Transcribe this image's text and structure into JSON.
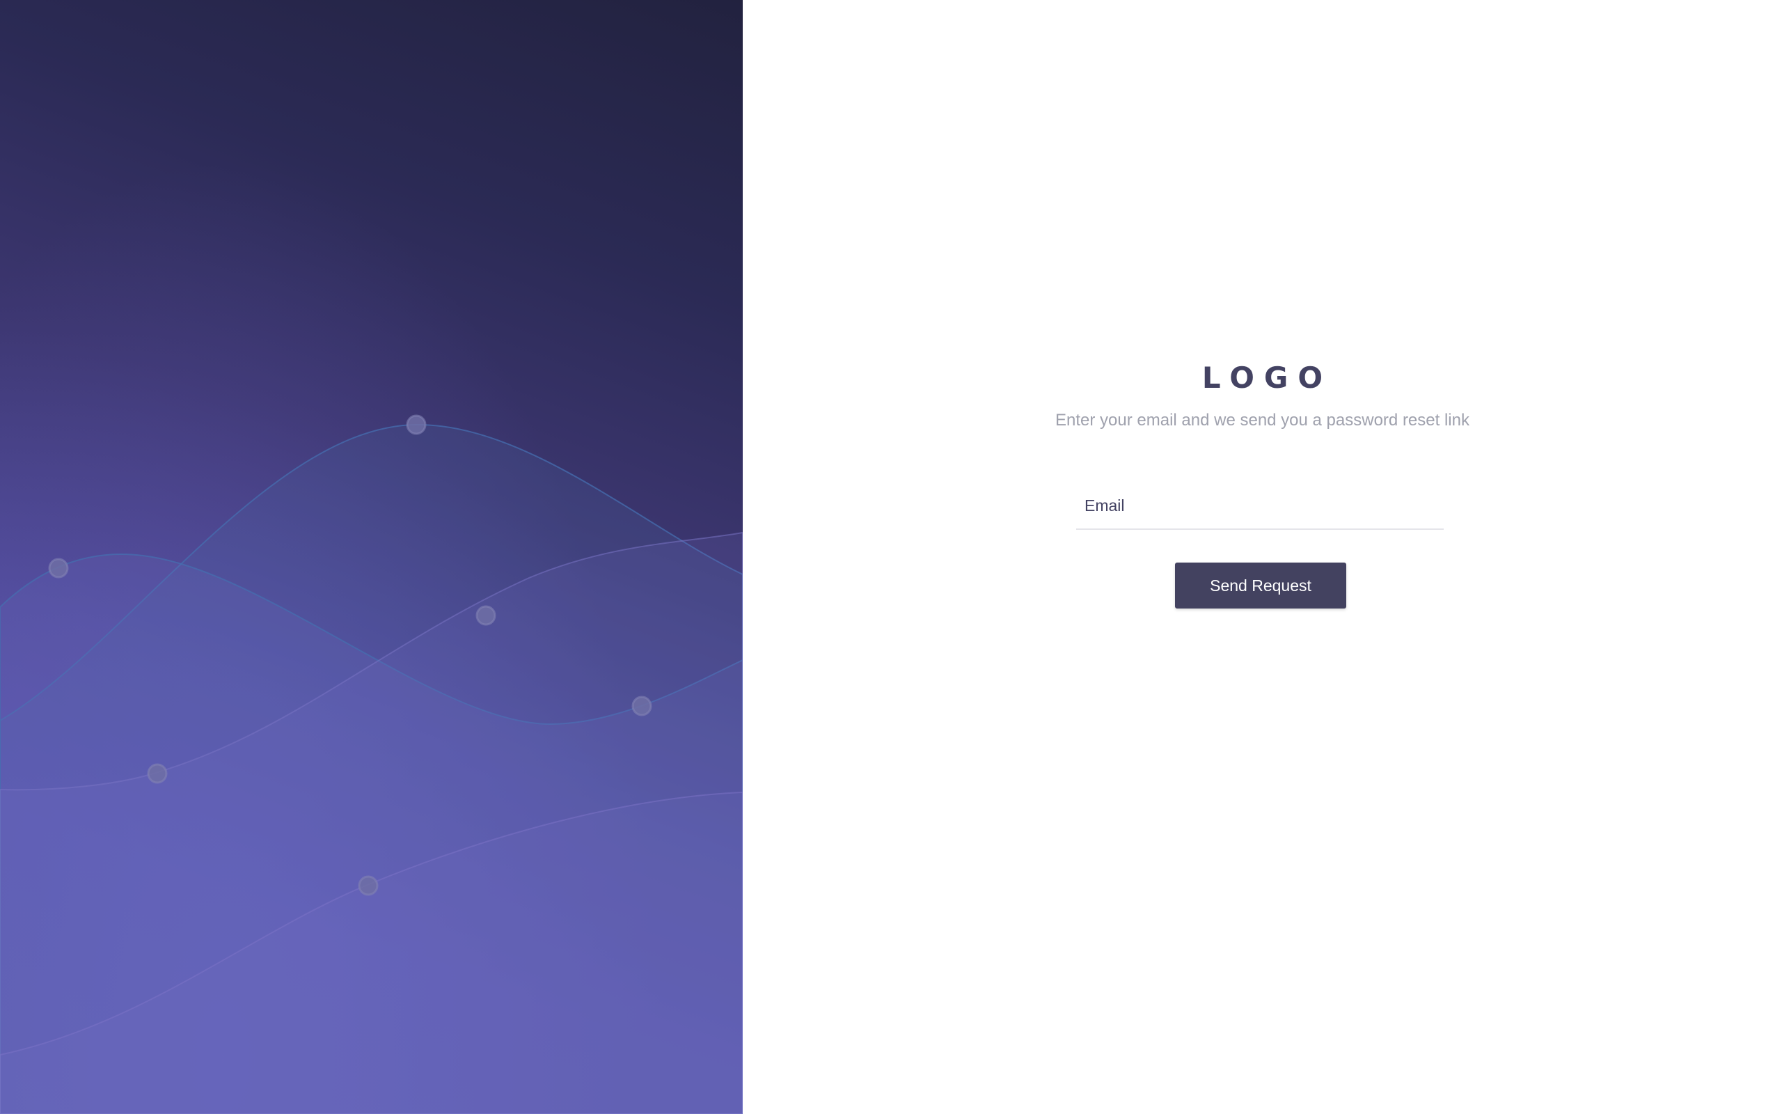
{
  "brand": {
    "logo_text": "LOGO"
  },
  "form": {
    "subtitle": "Enter your email and we send you a password reset link",
    "email_placeholder": "Email",
    "email_value": "",
    "submit_label": "Send Request"
  },
  "colors": {
    "primary": "#434260",
    "logo": "#434262",
    "subtitle": "#9fa1ad",
    "hero_dark": "#22223f",
    "hero_light": "#5b55aa",
    "wave_stroke": "#4a6aa8",
    "dot": "#6a6aa0"
  }
}
